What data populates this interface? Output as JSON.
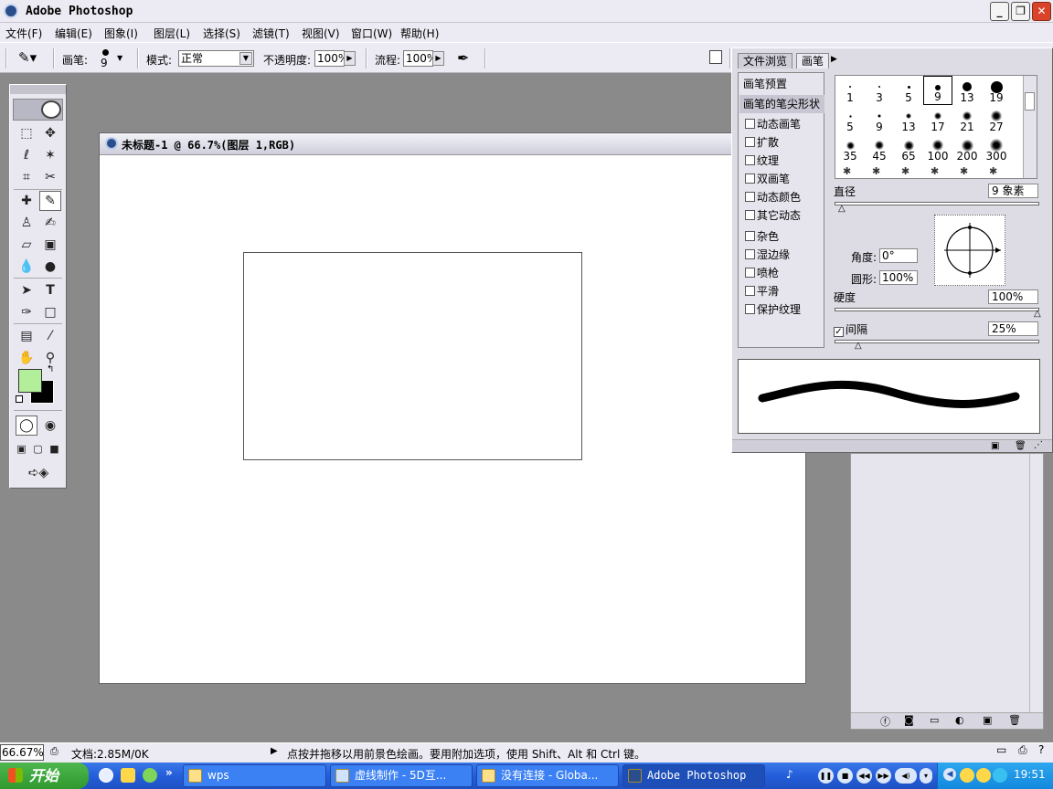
{
  "app": {
    "title": "Adobe Photoshop"
  },
  "menu": [
    "文件(F)",
    "编辑(E)",
    "图象(I)",
    "图层(L)",
    "选择(S)",
    "滤镜(T)",
    "视图(V)",
    "窗口(W)",
    "帮助(H)"
  ],
  "options": {
    "brush_label": "画笔:",
    "brush_size": "9",
    "mode_label": "模式:",
    "mode_value": "正常",
    "opacity_label": "不透明度:",
    "opacity_value": "100%",
    "flow_label": "流程:",
    "flow_value": "100%"
  },
  "document": {
    "title": "未标题-1 @ 66.7%(图层 1,RGB)"
  },
  "brush_palette": {
    "tabs": [
      "文件浏览",
      "画笔"
    ],
    "presets_label": "画笔预置",
    "tip_shape_label": "画笔的笔尖形状",
    "options": [
      {
        "label": "动态画笔",
        "checked": false
      },
      {
        "label": "扩散",
        "checked": false
      },
      {
        "label": "纹理",
        "checked": false
      },
      {
        "label": "双画笔",
        "checked": false
      },
      {
        "label": "动态颜色",
        "checked": false
      },
      {
        "label": "其它动态",
        "checked": false
      },
      {
        "label": "杂色",
        "checked": false
      },
      {
        "label": "湿边缘",
        "checked": false
      },
      {
        "label": "喷枪",
        "checked": false
      },
      {
        "label": "平滑",
        "checked": false
      },
      {
        "label": "保护纹理",
        "checked": false
      }
    ],
    "tips": [
      "1",
      "3",
      "5",
      "9",
      "13",
      "19",
      "5",
      "9",
      "13",
      "17",
      "21",
      "27",
      "35",
      "45",
      "65",
      "100",
      "200",
      "300"
    ],
    "diameter_label": "直径",
    "diameter_value": "9 象素",
    "angle_label": "角度:",
    "angle_value": "0°",
    "roundness_label": "圆形:",
    "roundness_value": "100%",
    "hardness_label": "硬度",
    "hardness_value": "100%",
    "spacing_label": "间隔",
    "spacing_value": "25%",
    "spacing_checked": true
  },
  "status": {
    "zoom": "66.67%",
    "doc_size": "文档:2.85M/0K",
    "hint": "点按并拖移以用前景色绘画。要用附加选项，使用 Shift、Alt 和 Ctrl 键。"
  },
  "taskbar": {
    "start_label": "开始",
    "tasks": [
      {
        "label": "wps",
        "active": false
      },
      {
        "label": "虚线制作 - 5D互...",
        "active": false
      },
      {
        "label": "没有连接 - Globa...",
        "active": false
      },
      {
        "label": "Adobe Photoshop",
        "active": true
      }
    ],
    "clock": "19:51"
  },
  "colors": {
    "foreground": "#b3ef9b",
    "background": "#000000",
    "taskbar": "#245edb",
    "start": "#2f9a2f"
  }
}
